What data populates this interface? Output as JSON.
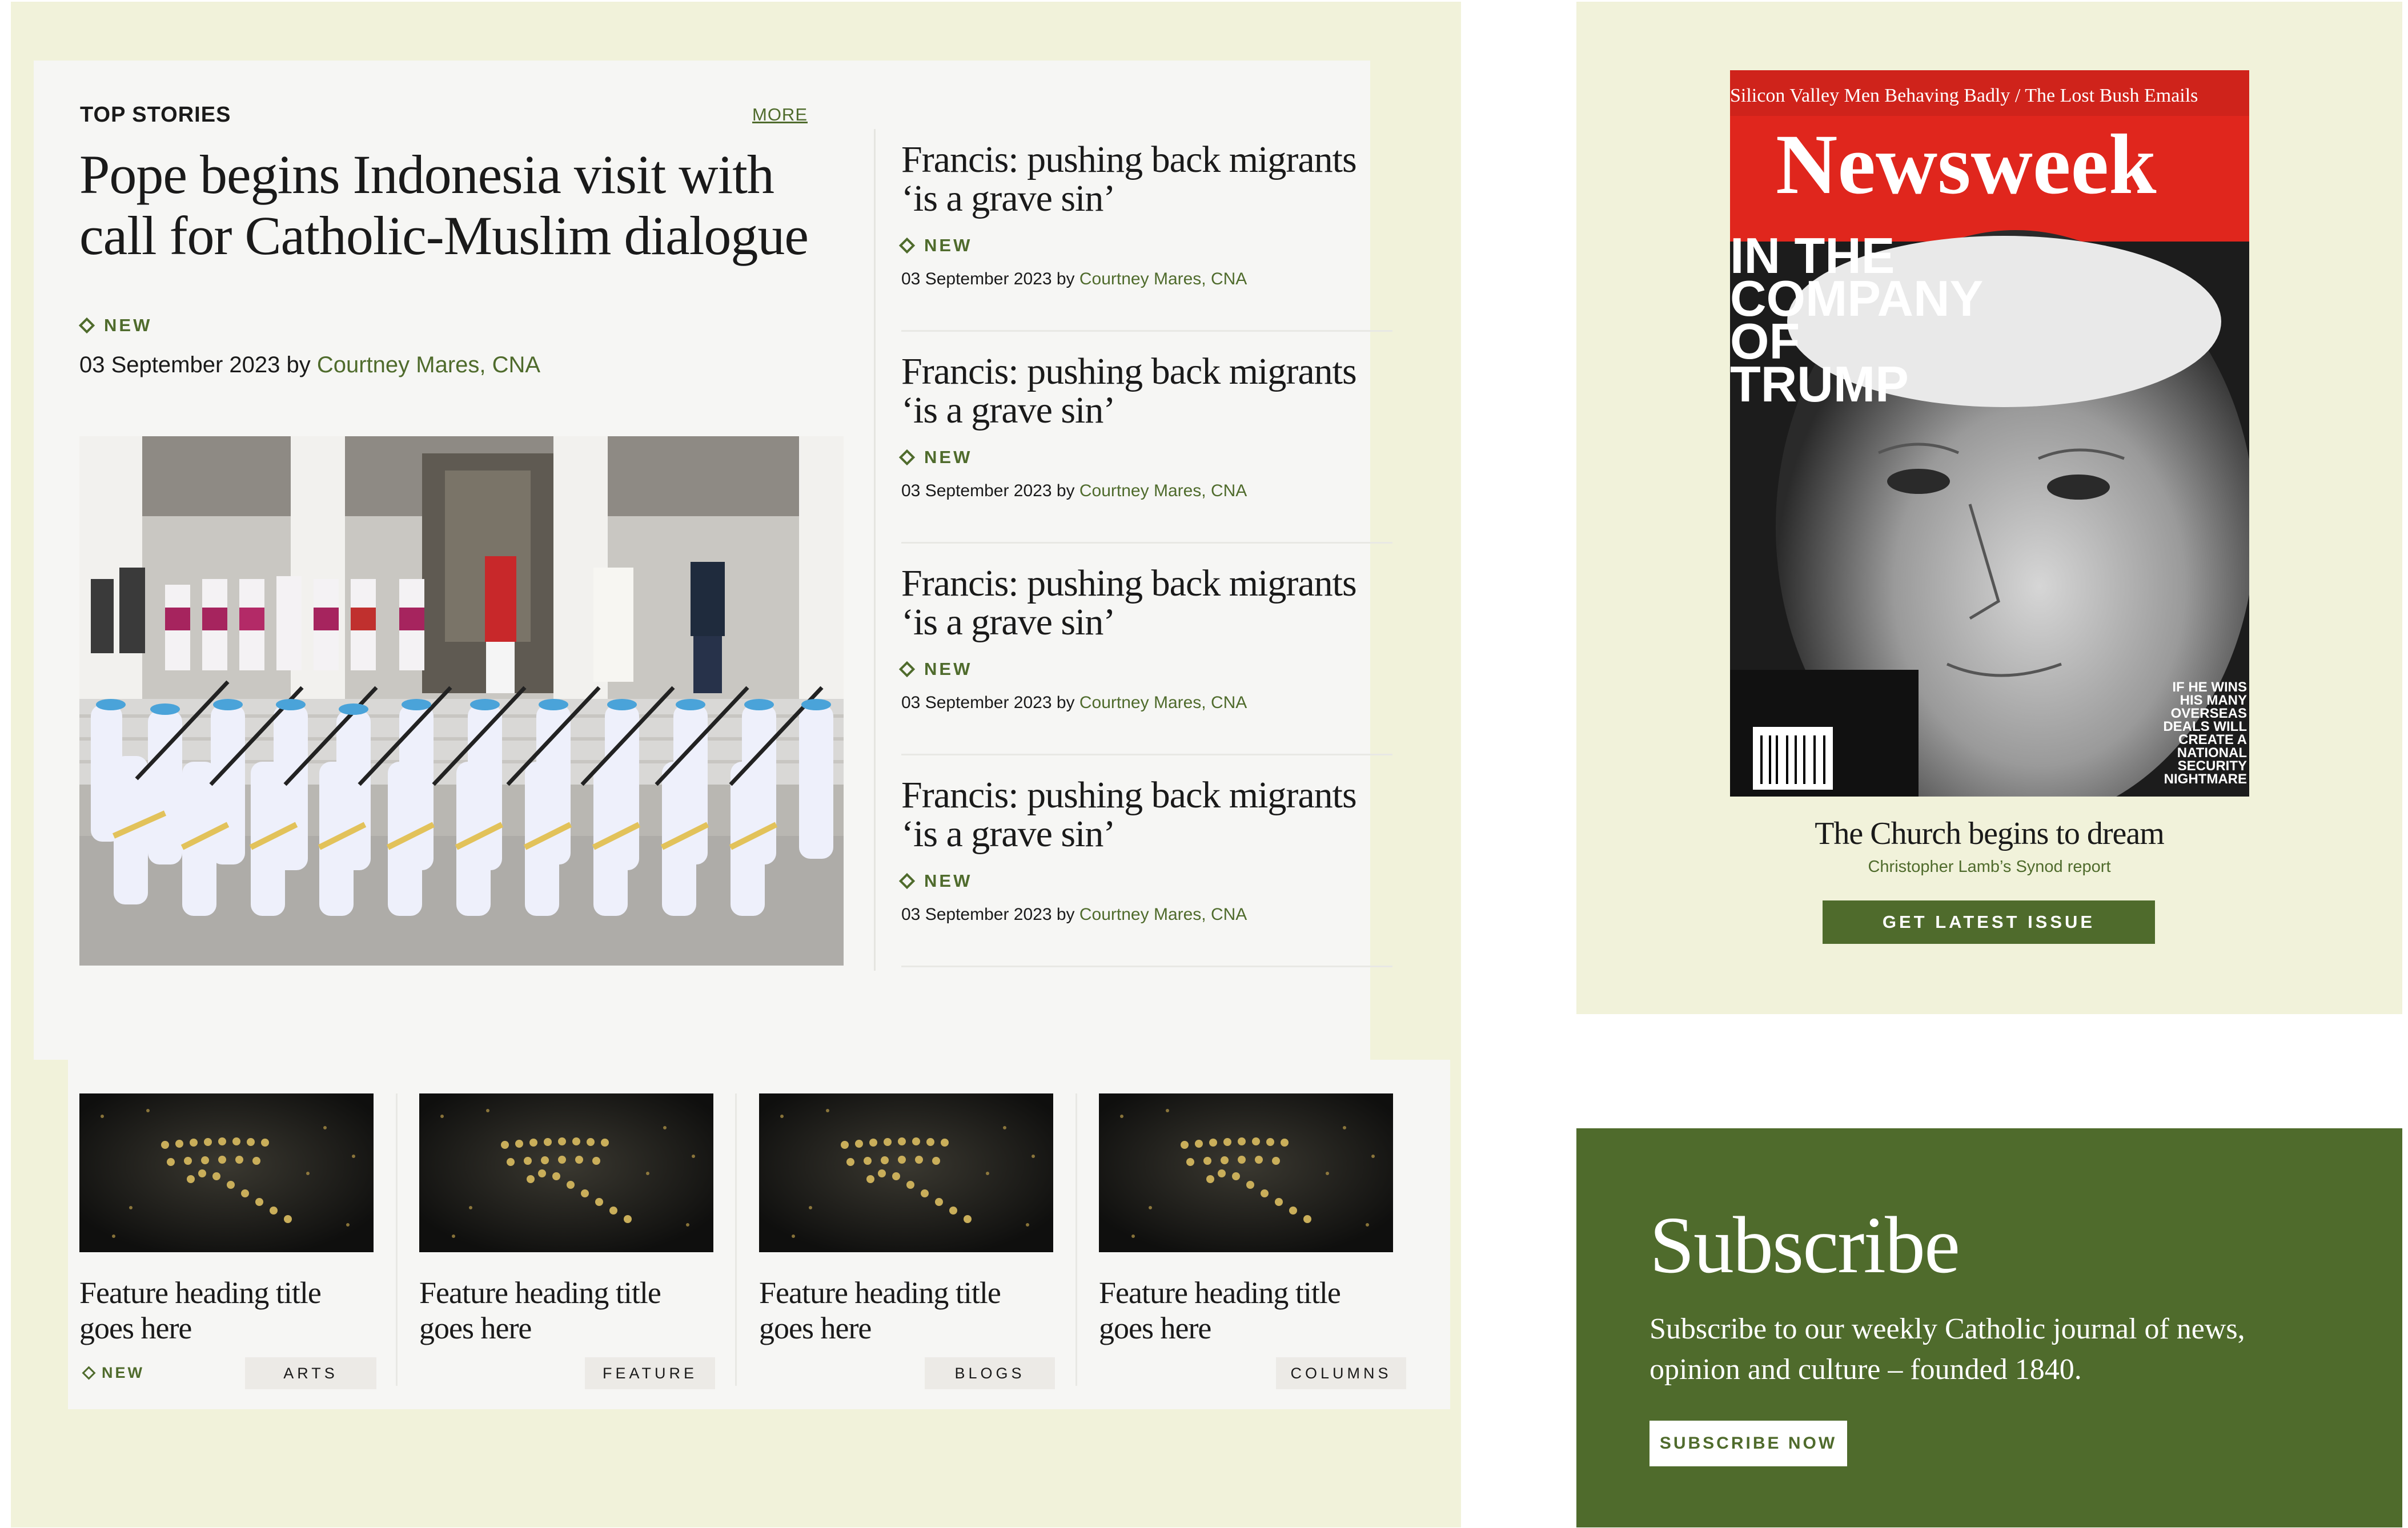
{
  "top_stories": {
    "section_title": "TOP STORIES",
    "more_label": "MORE",
    "lead": {
      "title": "Pope begins Indonesia visit with call for Catholic-Muslim dialogue",
      "badge": "NEW",
      "date_by": "03 September 2023 by ",
      "author": "Courtney Mares, CNA"
    },
    "side_stories": [
      {
        "title": "Francis: pushing back migrants ‘is a grave sin’",
        "badge": "NEW",
        "date_by": "03 September 2023 by ",
        "author": "Courtney Mares, CNA"
      },
      {
        "title": "Francis: pushing back migrants ‘is a grave sin’",
        "badge": "NEW",
        "date_by": "03 September 2023 by ",
        "author": "Courtney Mares, CNA"
      },
      {
        "title": "Francis: pushing back migrants ‘is a grave sin’",
        "badge": "NEW",
        "date_by": "03 September 2023 by ",
        "author": "Courtney Mares, CNA"
      },
      {
        "title": "Francis: pushing back migrants ‘is a grave sin’",
        "badge": "NEW",
        "date_by": "03 September 2023 by ",
        "author": "Courtney Mares, CNA"
      }
    ]
  },
  "features": [
    {
      "title": "Feature heading title goes here",
      "badge": "NEW",
      "tag": "ARTS"
    },
    {
      "title": "Feature heading title goes here",
      "badge": "",
      "tag": "FEATURE"
    },
    {
      "title": "Feature heading title goes here",
      "badge": "",
      "tag": "BLOGS"
    },
    {
      "title": "Feature heading title goes here",
      "badge": "",
      "tag": "COLUMNS"
    }
  ],
  "magazine": {
    "cover": {
      "topline": "Silicon Valley Men Behaving Badly / The Lost Bush Emails",
      "masthead": "Newsweek",
      "headline_lines": [
        "IN THE",
        "COMPANY",
        "OF",
        "TRUMP"
      ],
      "side_text": [
        "IF HE WINS",
        "HIS MANY",
        "OVERSEAS",
        "DEALS WILL",
        "CREATE A",
        "NATIONAL",
        "SECURITY",
        "NIGHTMARE"
      ]
    },
    "caption_title": "The Church begins to dream",
    "caption_sub": "Christopher Lamb’s Synod report",
    "button_label": "GET LATEST ISSUE"
  },
  "subscribe": {
    "title": "Subscribe",
    "text": "Subscribe to our weekly Catholic journal of news, opinion and culture – founded 1840.",
    "button_label": "SUBSCRIBE NOW"
  },
  "colors": {
    "accent_green": "#4f6b2c",
    "panel_cream": "#f1f2da",
    "card_bg": "#f6f6f4",
    "newsweek_red": "#e0261d"
  }
}
